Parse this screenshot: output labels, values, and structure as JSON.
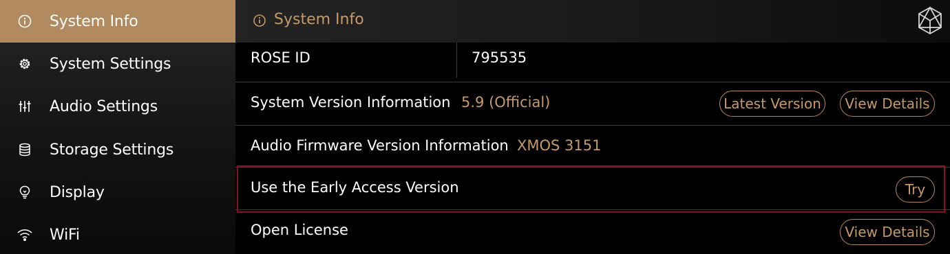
{
  "sidebar": {
    "items": [
      {
        "label": "System Info",
        "icon": "info-icon",
        "active": true
      },
      {
        "label": "System Settings",
        "icon": "gear-icon",
        "active": false
      },
      {
        "label": "Audio Settings",
        "icon": "sliders-icon",
        "active": false
      },
      {
        "label": "Storage Settings",
        "icon": "database-icon",
        "active": false
      },
      {
        "label": "Display",
        "icon": "lightbulb-icon",
        "active": false
      },
      {
        "label": "WiFi",
        "icon": "wifi-icon",
        "active": false
      }
    ]
  },
  "header": {
    "title": "System Info",
    "icon": "info-icon",
    "logo": "rose-logo-icon"
  },
  "rows": {
    "rose_id": {
      "label": "ROSE ID",
      "value": "795535"
    },
    "system_version": {
      "label": "System Version Information",
      "value": "5.9 (Official)",
      "latest_button": "Latest Version",
      "details_button": "View Details"
    },
    "audio_firmware": {
      "label": "Audio Firmware Version Information",
      "value": "XMOS 3151"
    },
    "early_access": {
      "label": "Use the Early Access Version",
      "try_button": "Try"
    },
    "open_license": {
      "label": "Open License",
      "details_button": "View Details"
    }
  },
  "colors": {
    "accent": "#c69a66",
    "sidebar_active": "#b18b5f",
    "highlight_border": "#8b0f1f",
    "background": "#000000"
  }
}
